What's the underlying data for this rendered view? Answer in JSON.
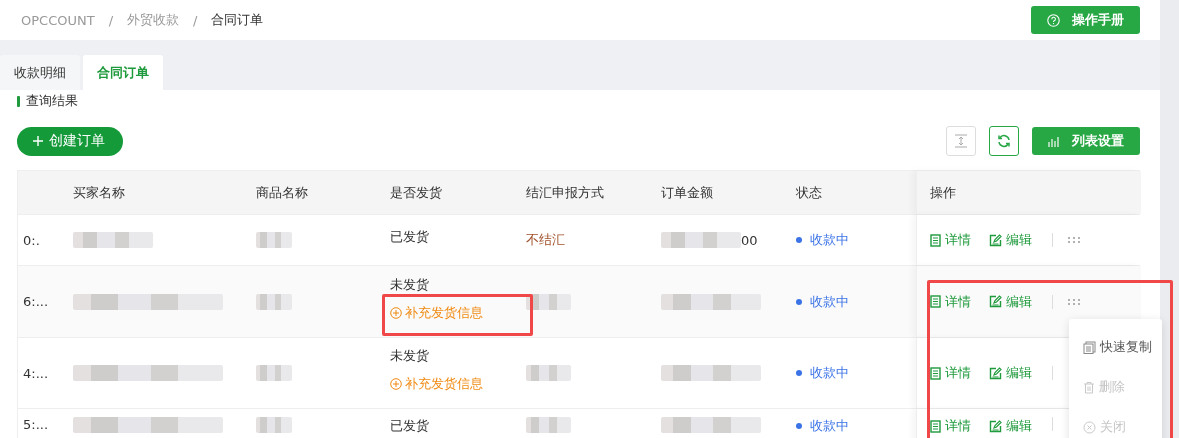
{
  "breadcrumb": {
    "separator": "/",
    "items": [
      {
        "label": "OPCCOUNT",
        "selected": false
      },
      {
        "label": "外贸收款",
        "selected": false
      },
      {
        "label": "合同订单",
        "selected": true
      }
    ]
  },
  "help_button": "操作手册",
  "tabs": [
    {
      "label": "收款明细",
      "selected": false
    },
    {
      "label": "合同订单",
      "selected": true
    }
  ],
  "section_title": "查询结果",
  "create_button": "创建订单",
  "settings_button": "列表设置",
  "table": {
    "columns": [
      "买家名称",
      "商品名称",
      "是否发货",
      "结汇申报方式",
      "订单金额",
      "状态",
      "操作"
    ],
    "rows": [
      {
        "column_1": "0:.",
        "buyer": {
          "kind": "redacted"
        },
        "product": {
          "kind": "redacted"
        },
        "shipping": "已发货",
        "supplement_link": null,
        "settlement": {
          "kind": "text",
          "text": "不结汇"
        },
        "amount": {
          "kind": "partly_redacted",
          "text": "00"
        },
        "status": {
          "text": "收款中",
          "color": "#3b73e6"
        },
        "actions": [
          "详情",
          "编辑"
        ],
        "more": true,
        "menu_open": false
      },
      {
        "column_1": "6:...",
        "buyer": {
          "kind": "redacted"
        },
        "product": {
          "kind": "redacted"
        },
        "shipping": "未发货",
        "supplement_link": "补充发货信息",
        "settlement": {
          "kind": "redacted"
        },
        "amount": {
          "kind": "redacted"
        },
        "status": {
          "text": "收款中",
          "color": "#3b73e6"
        },
        "actions": [
          "详情",
          "编辑"
        ],
        "more": true,
        "menu_open": true
      },
      {
        "column_1": "4:...",
        "buyer": {
          "kind": "redacted"
        },
        "product": {
          "kind": "redacted"
        },
        "shipping": "未发货",
        "supplement_link": "补充发货信息",
        "settlement": {
          "kind": "redacted"
        },
        "amount": {
          "kind": "redacted"
        },
        "status": {
          "text": "收款中",
          "color": "#3b73e6"
        },
        "actions": [
          "详情",
          "编辑"
        ],
        "more": false,
        "menu_open": false
      },
      {
        "column_1": "5:...",
        "buyer": {
          "kind": "redacted"
        },
        "product": {
          "kind": "redacted"
        },
        "shipping": "已发货",
        "supplement_link": null,
        "settlement": {
          "kind": "redacted"
        },
        "amount": {
          "kind": "redacted"
        },
        "status": {
          "text": "收款中",
          "color": "#3b73e6"
        },
        "actions": [
          "详情",
          "编辑"
        ],
        "more": false,
        "menu_open": false
      }
    ]
  },
  "more_menu": {
    "items": [
      {
        "label": "快速复制",
        "disabled": false
      },
      {
        "label": "删除",
        "disabled": true
      },
      {
        "label": "关闭",
        "disabled": true
      }
    ]
  },
  "annotations": [
    {
      "kind": "frame",
      "color": "#f04848"
    },
    {
      "kind": "frame",
      "color": "#f04848"
    }
  ]
}
